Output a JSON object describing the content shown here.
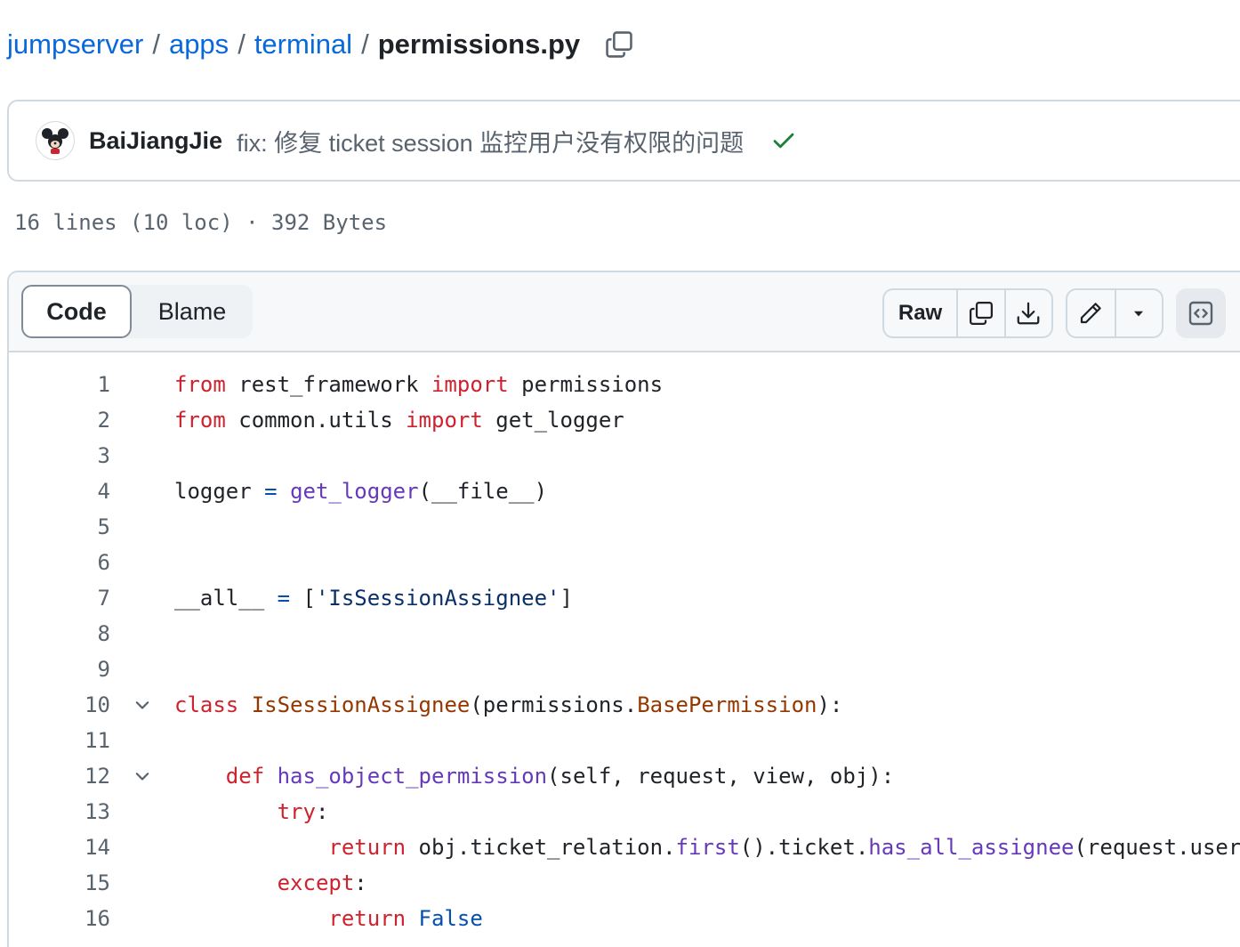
{
  "breadcrumb": {
    "repo": "jumpserver",
    "dir1": "apps",
    "dir2": "terminal",
    "separator": "/",
    "file": "permissions.py"
  },
  "icons": {
    "copy_path": "copy-icon",
    "status": "check-icon",
    "copy": "copy-icon",
    "download": "download-icon",
    "edit": "pencil-icon",
    "more": "triangle-down-icon",
    "symbols": "code-square-icon",
    "fold": "chevron-down-icon"
  },
  "commit": {
    "author": "BaiJiangJie",
    "message": "fix: 修复 ticket session 监控用户没有权限的问题",
    "status_color": "#1a7f37"
  },
  "file_meta": {
    "lines": "16 lines (10 loc)",
    "sep": "·",
    "size": "392 Bytes"
  },
  "toolbar": {
    "tab_code": "Code",
    "tab_blame": "Blame",
    "raw": "Raw"
  },
  "code_lines": [
    {
      "n": "1",
      "fold": false,
      "tokens": [
        {
          "t": "from",
          "c": "kw"
        },
        {
          "t": " rest_framework "
        },
        {
          "t": "import",
          "c": "kw"
        },
        {
          "t": " permissions"
        }
      ]
    },
    {
      "n": "2",
      "fold": false,
      "tokens": [
        {
          "t": "from",
          "c": "kw"
        },
        {
          "t": " common.utils "
        },
        {
          "t": "import",
          "c": "kw"
        },
        {
          "t": " get_logger"
        }
      ]
    },
    {
      "n": "3",
      "fold": false,
      "tokens": []
    },
    {
      "n": "4",
      "fold": false,
      "tokens": [
        {
          "t": "logger "
        },
        {
          "t": "=",
          "c": "con"
        },
        {
          "t": " "
        },
        {
          "t": "get_logger",
          "c": "fn"
        },
        {
          "t": "(__file__)"
        }
      ]
    },
    {
      "n": "5",
      "fold": false,
      "tokens": []
    },
    {
      "n": "6",
      "fold": false,
      "tokens": []
    },
    {
      "n": "7",
      "fold": false,
      "tokens": [
        {
          "t": "__all__ "
        },
        {
          "t": "=",
          "c": "con"
        },
        {
          "t": " ["
        },
        {
          "t": "'IsSessionAssignee'",
          "c": "str"
        },
        {
          "t": "]"
        }
      ]
    },
    {
      "n": "8",
      "fold": false,
      "tokens": []
    },
    {
      "n": "9",
      "fold": false,
      "tokens": []
    },
    {
      "n": "10",
      "fold": true,
      "tokens": [
        {
          "t": "class",
          "c": "kw"
        },
        {
          "t": " "
        },
        {
          "t": "IsSessionAssignee",
          "c": "cls"
        },
        {
          "t": "(permissions."
        },
        {
          "t": "BasePermission",
          "c": "cls"
        },
        {
          "t": "):"
        }
      ]
    },
    {
      "n": "11",
      "fold": false,
      "tokens": []
    },
    {
      "n": "12",
      "fold": true,
      "tokens": [
        {
          "t": "    "
        },
        {
          "t": "def",
          "c": "kw"
        },
        {
          "t": " "
        },
        {
          "t": "has_object_permission",
          "c": "fn"
        },
        {
          "t": "(self, request, view, obj):"
        }
      ]
    },
    {
      "n": "13",
      "fold": false,
      "tokens": [
        {
          "t": "        "
        },
        {
          "t": "try",
          "c": "kw"
        },
        {
          "t": ":"
        }
      ]
    },
    {
      "n": "14",
      "fold": false,
      "tokens": [
        {
          "t": "            "
        },
        {
          "t": "return",
          "c": "kw"
        },
        {
          "t": " obj.ticket_relation."
        },
        {
          "t": "first",
          "c": "fn"
        },
        {
          "t": "().ticket."
        },
        {
          "t": "has_all_assignee",
          "c": "fn"
        },
        {
          "t": "(request.user)"
        }
      ]
    },
    {
      "n": "15",
      "fold": false,
      "tokens": [
        {
          "t": "        "
        },
        {
          "t": "except",
          "c": "kw"
        },
        {
          "t": ":"
        }
      ]
    },
    {
      "n": "16",
      "fold": false,
      "tokens": [
        {
          "t": "            "
        },
        {
          "t": "return",
          "c": "kw"
        },
        {
          "t": " "
        },
        {
          "t": "False",
          "c": "con"
        }
      ]
    }
  ]
}
